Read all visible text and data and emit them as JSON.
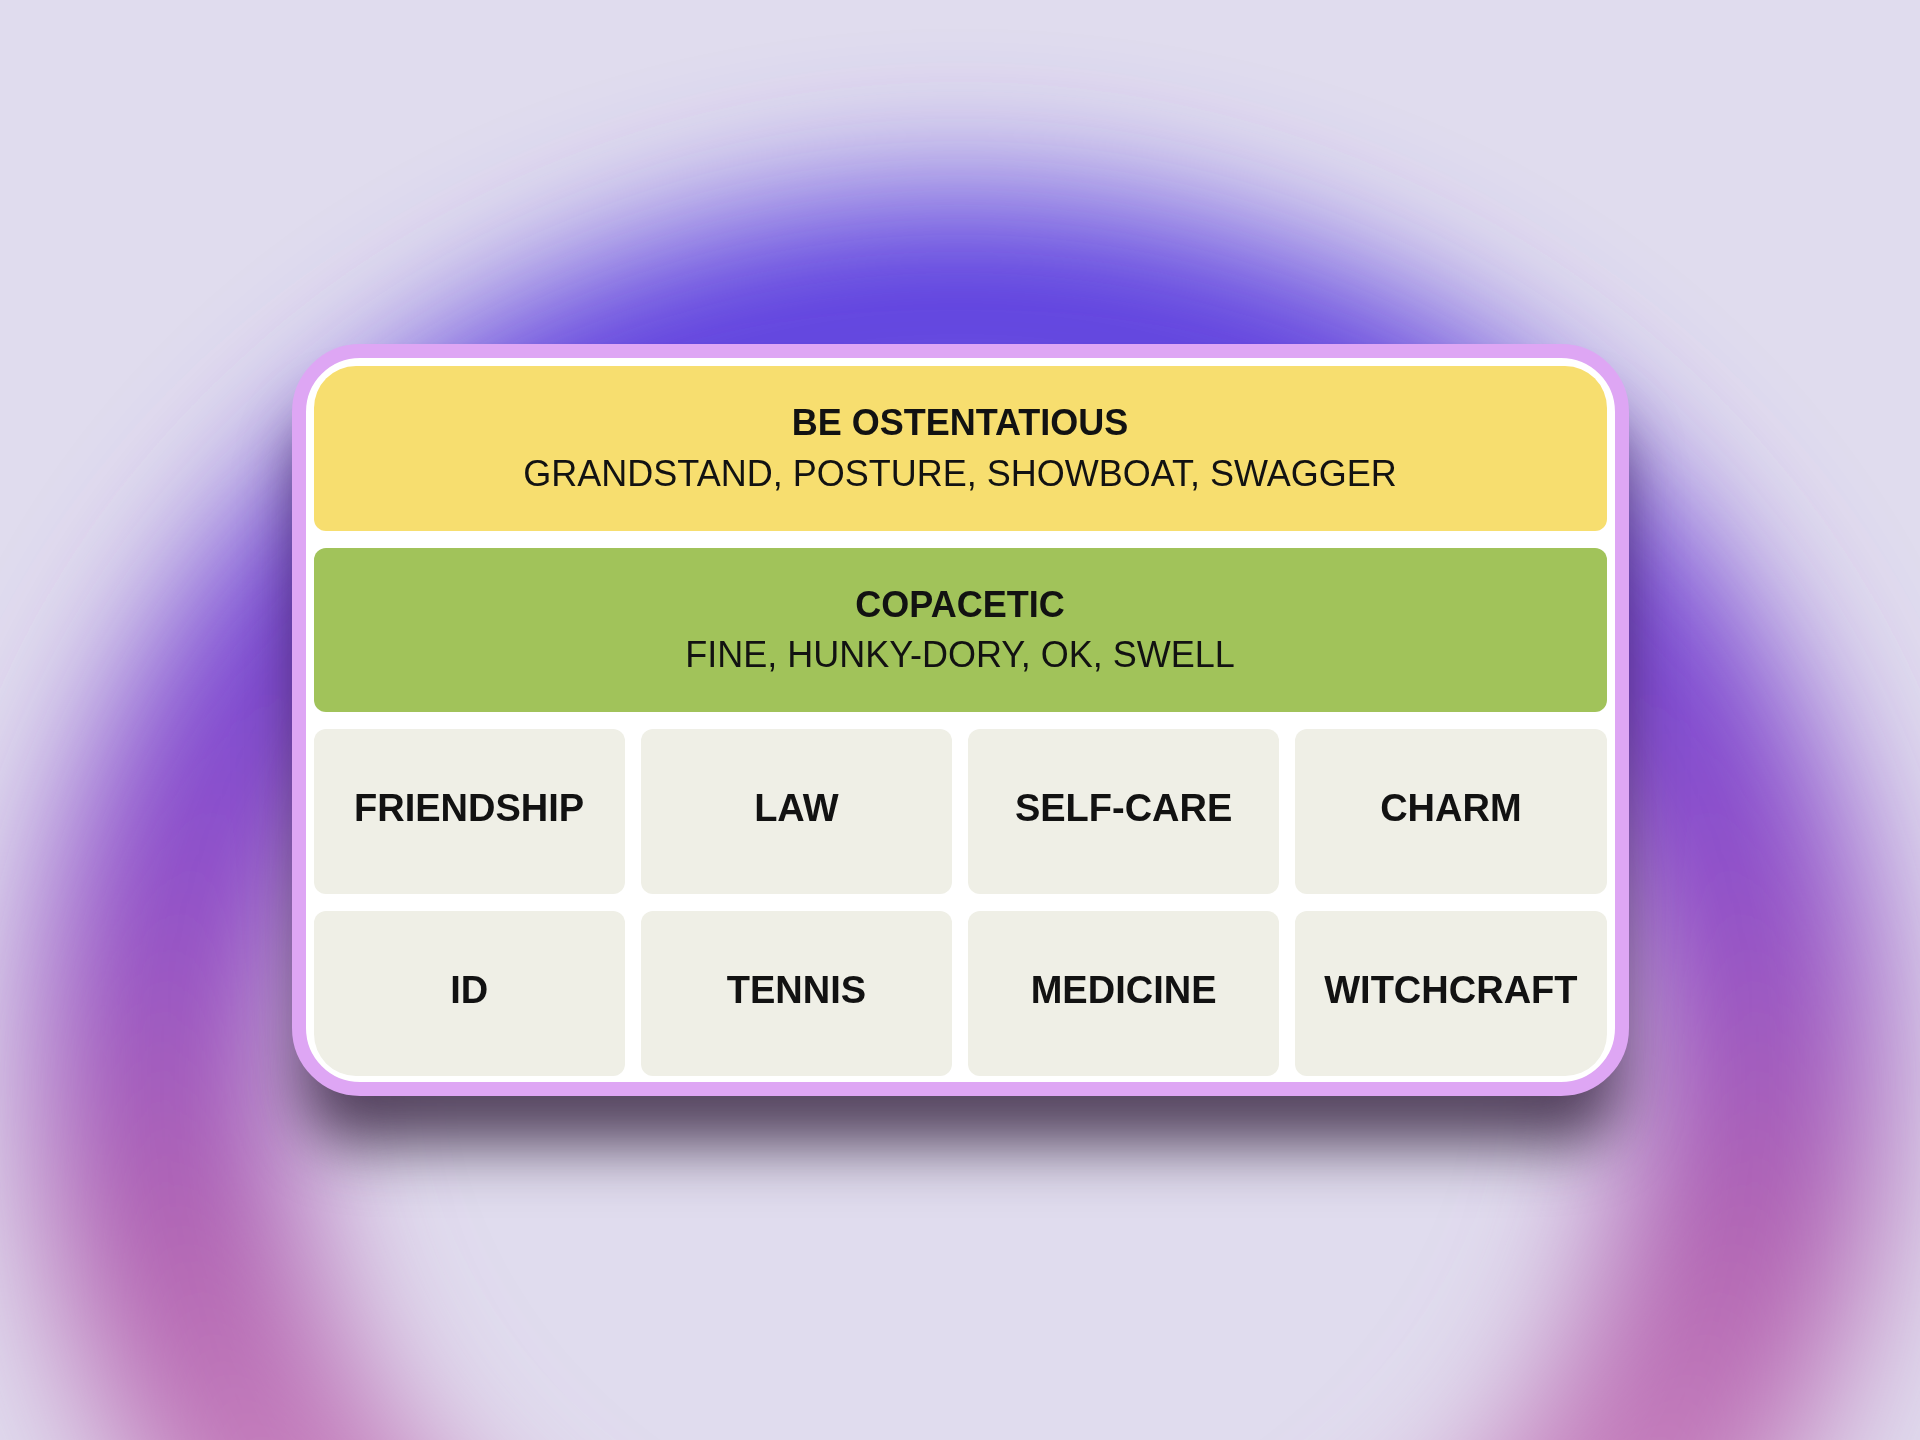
{
  "solved_groups": [
    {
      "title": "BE OSTENTATIOUS",
      "words": "GRANDSTAND, POSTURE, SHOWBOAT, SWAGGER",
      "color": "#f7de6f"
    },
    {
      "title": "COPACETIC",
      "words": "FINE, HUNKY-DORY, OK, SWELL",
      "color": "#a1c35a"
    }
  ],
  "tiles": [
    "FRIENDSHIP",
    "LAW",
    "SELF-CARE",
    "CHARM",
    "ID",
    "TENNIS",
    "MEDICINE",
    "WITCHCRAFT"
  ]
}
